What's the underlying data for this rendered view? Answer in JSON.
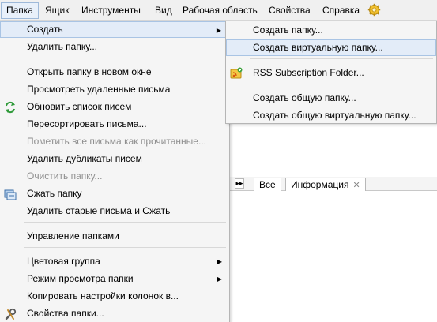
{
  "menubar": {
    "items": [
      "Папка",
      "Ящик",
      "Инструменты",
      "Вид",
      "Рабочая область",
      "Свойства",
      "Справка"
    ],
    "extra_icon": "gear-icon"
  },
  "folder_menu": {
    "items": [
      {
        "label": "Создать",
        "submenu": true,
        "highlighted": true
      },
      {
        "label": "Удалить папку..."
      },
      {
        "label": "Открыть папку в новом окне"
      },
      {
        "label": "Просмотреть удаленные письма"
      },
      {
        "label": "Обновить список писем",
        "icon": "refresh-icon"
      },
      {
        "label": "Пересортировать письма..."
      },
      {
        "label": "Пометить все письма как прочитанные...",
        "disabled": true
      },
      {
        "label": "Удалить дубликаты писем"
      },
      {
        "label": "Очистить папку...",
        "disabled": true
      },
      {
        "label": "Сжать папку",
        "icon": "compress-icon"
      },
      {
        "label": "Удалить старые письма и Сжать"
      },
      {
        "label": "Управление папками"
      },
      {
        "label": "Цветовая группа",
        "submenu": true
      },
      {
        "label": "Режим просмотра папки",
        "submenu": true
      },
      {
        "label": "Копировать настройки колонок в..."
      },
      {
        "label": "Свойства папки...",
        "icon": "properties-icon"
      }
    ]
  },
  "create_submenu": {
    "items": [
      {
        "label": "Создать папку..."
      },
      {
        "label": "Создать виртуальную папку...",
        "highlighted": true
      },
      {
        "label": "RSS Subscription Folder...",
        "icon": "rss-folder-icon"
      },
      {
        "label": "Создать общую папку..."
      },
      {
        "label": "Создать общую виртуальную папку..."
      }
    ]
  },
  "tabs": {
    "all_label": "Все",
    "info_label": "Информация",
    "close_glyph": "✕",
    "nav_glyph": "▸▸"
  },
  "colors": {
    "highlight_bg": "#e3ecf8",
    "highlight_border": "#a9c4e4",
    "menu_bg": "#f5f5f5",
    "disabled_text": "#8f8f8f"
  }
}
